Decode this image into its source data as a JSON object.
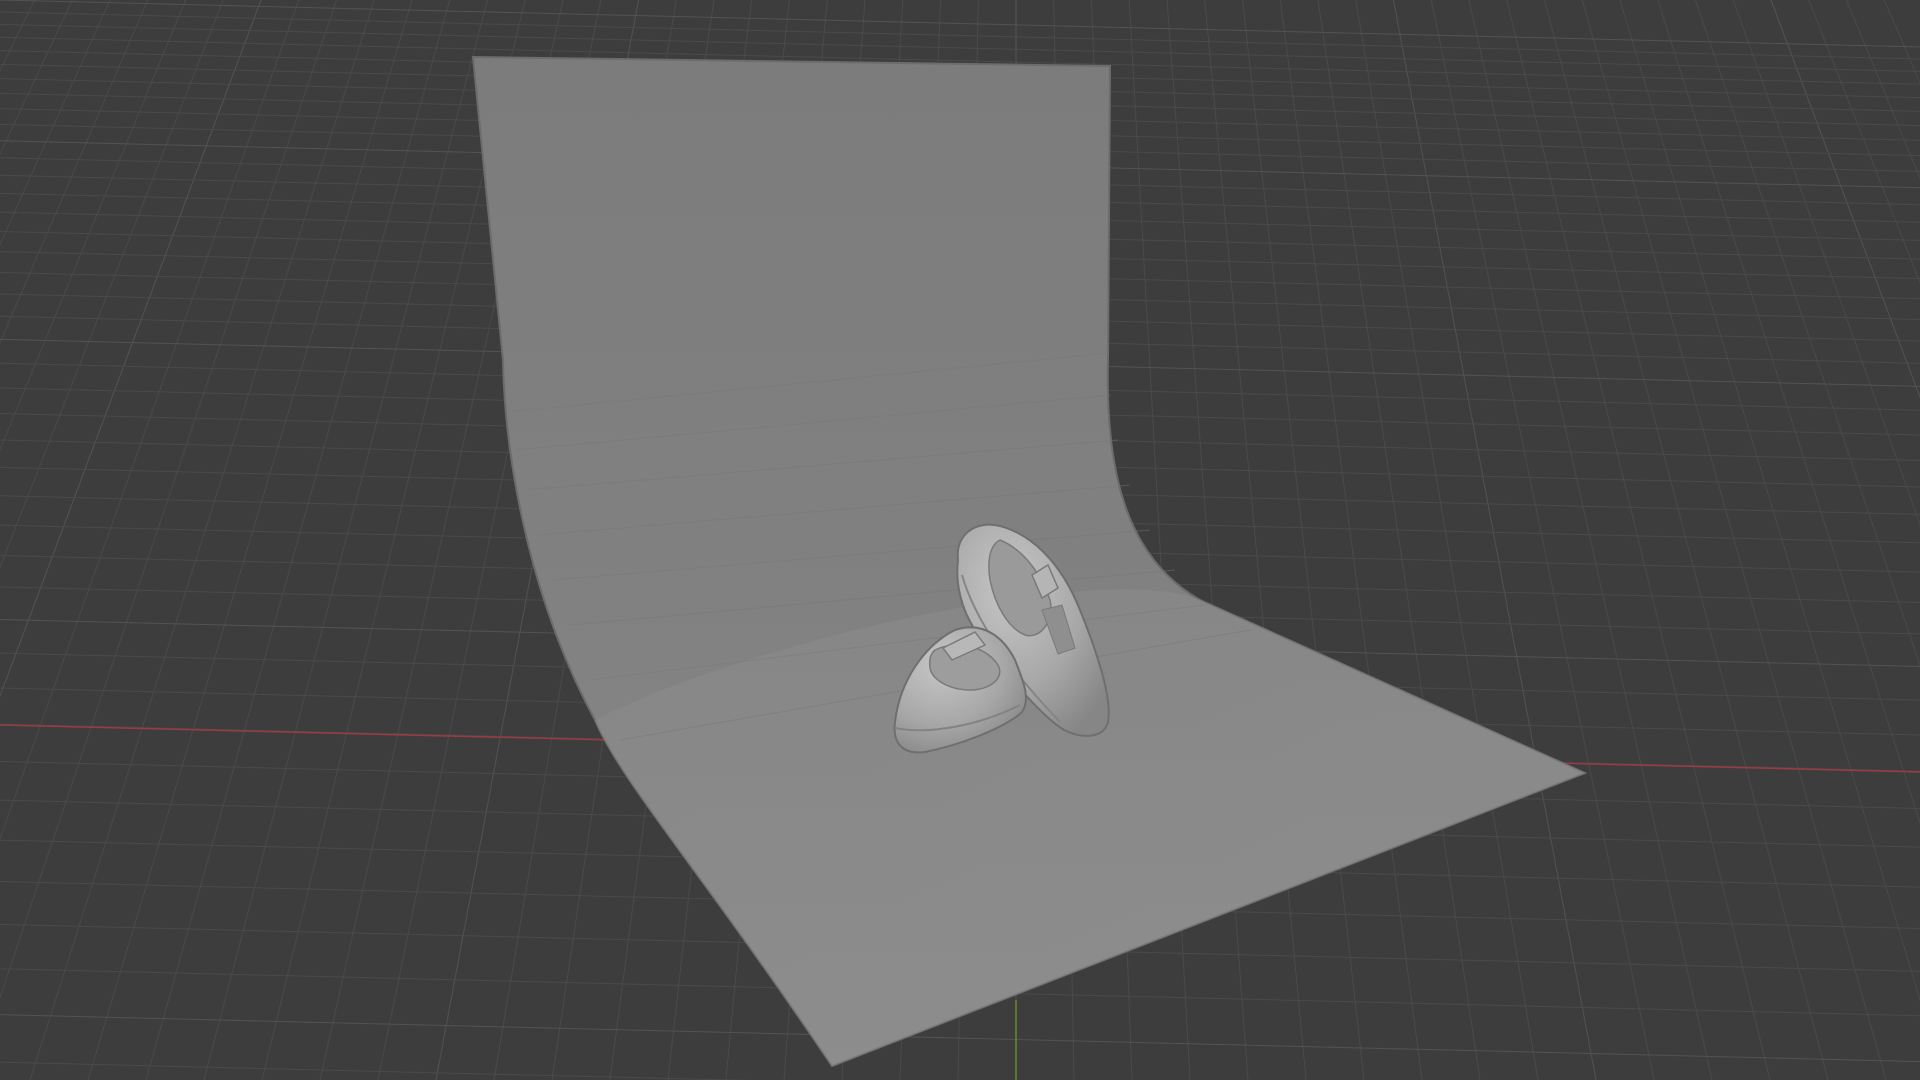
{
  "viewport": {
    "background": "#3d3d3d",
    "grid_minor_color": "#4a4a4a",
    "grid_major_color": "#535353",
    "x_axis_color": "#9a3b44",
    "y_axis_color": "#6a8a2a"
  },
  "scene": {
    "backdrop": {
      "name": "photo-backdrop",
      "color_top": "#7a7a7a",
      "color_floor": "#8e8e8e",
      "edge_color": "#6a6a6a"
    },
    "shoes": {
      "name": "shoes-model",
      "color": "#a9a9a9",
      "shadow_color": "#6f6f6f",
      "highlight_color": "#c4c4c4"
    }
  }
}
